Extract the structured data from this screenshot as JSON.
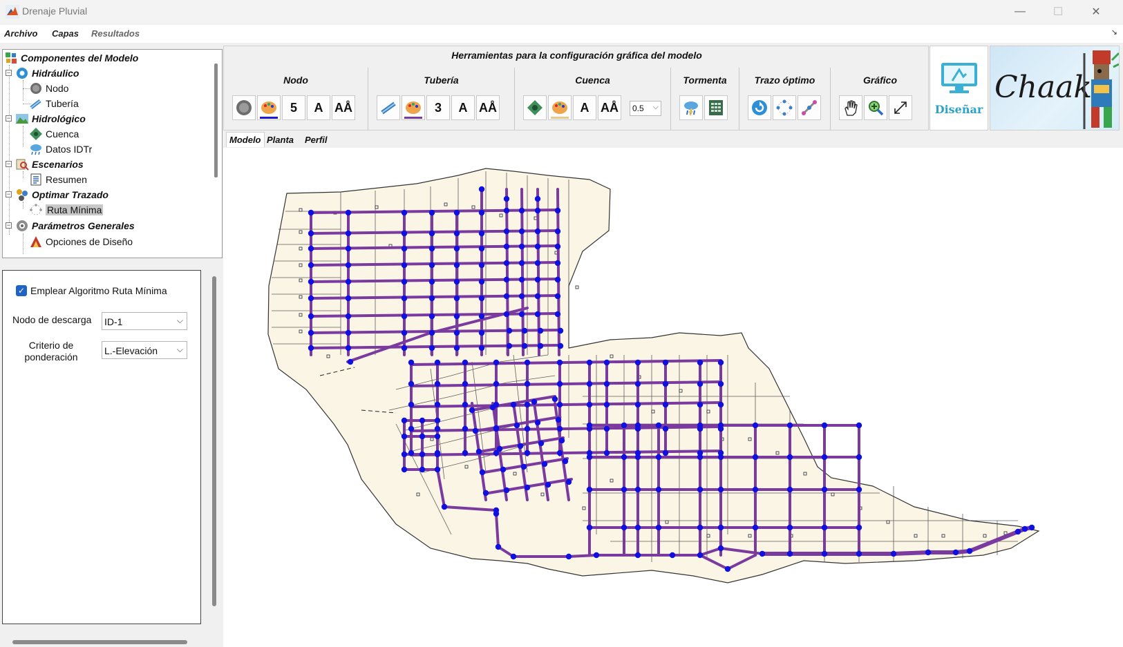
{
  "window": {
    "title": "Drenaje Pluvial",
    "minimize": "—",
    "maximize": "☐",
    "close": "✕"
  },
  "menu": {
    "archivo": "Archivo",
    "capas": "Capas",
    "resultados": "Resultados",
    "corner": "↘"
  },
  "tree": {
    "root": "Componentes del Modelo",
    "hidraulico": "Hidráulico",
    "nodo": "Nodo",
    "tuberia": "Tubería",
    "hidrologico": "Hidrológico",
    "cuenca": "Cuenca",
    "datos_idtr": "Datos IDTr",
    "escenarios": "Escenarios",
    "resumen": "Resumen",
    "optimar": "Optimar Trazado",
    "ruta_minima": "Ruta Mínima",
    "parametros": "Parámetros Generales",
    "opciones": "Opciones de Diseño"
  },
  "options": {
    "use_min_route_label": "Emplear Algoritmo Ruta Mínima",
    "use_min_route_checked": true,
    "discharge_node_label": "Nodo de descarga",
    "discharge_node_value": "ID-1",
    "criterion_label_1": "Criterio de",
    "criterion_label_2": "ponderación",
    "criterion_value": "L.-Elevación"
  },
  "toolbar": {
    "title": "Herramientas para la configuración gráfica del modelo",
    "nodo": {
      "title": "Nodo",
      "size": "5",
      "font": "A",
      "font_size": "AÅ"
    },
    "tuberia": {
      "title": "Tubería",
      "size": "3",
      "font": "A",
      "font_size": "AÅ"
    },
    "cuenca": {
      "title": "Cuenca",
      "font": "A",
      "font_size": "AÅ",
      "alpha": "0.5"
    },
    "tormenta": {
      "title": "Tormenta"
    },
    "trazo": {
      "title": "Trazo óptimo"
    },
    "grafico": {
      "title": "Gráfico"
    },
    "design_button": "Diseñar",
    "logo_text": "Chaak"
  },
  "tabs": {
    "modelo": "Modelo",
    "planta": "Planta",
    "perfil": "Perfil"
  },
  "colors": {
    "pipe": "#7a3a9e",
    "node": "#1010e0",
    "basin": "#fbf5e6",
    "accent": "#2ea2c8",
    "check": "#1f63c7"
  }
}
